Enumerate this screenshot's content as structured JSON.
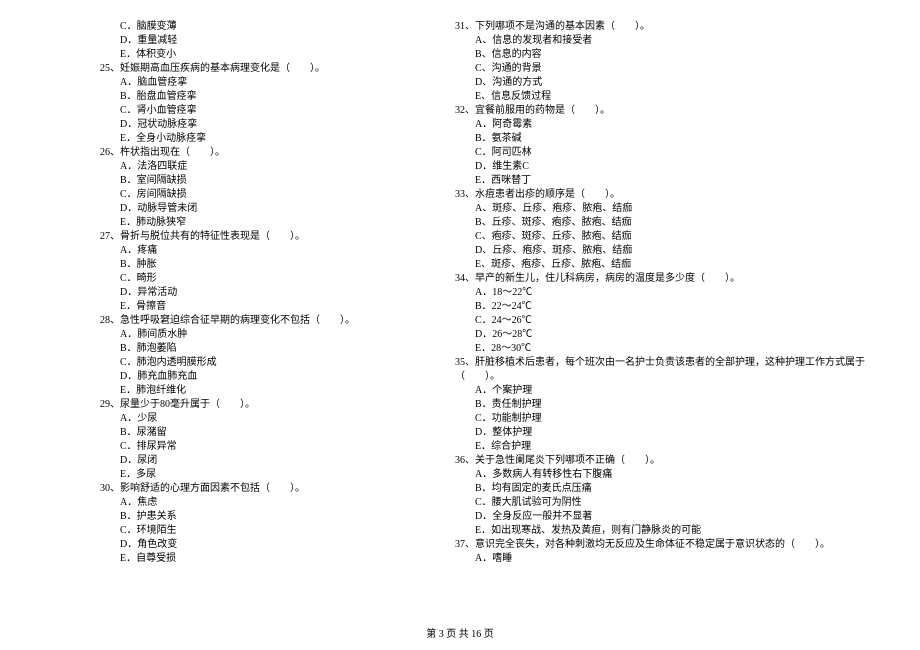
{
  "left_column": [
    {
      "type": "option",
      "text": "C．脑膜变薄"
    },
    {
      "type": "option",
      "text": "D．重量减轻"
    },
    {
      "type": "option",
      "text": "E．体积变小"
    },
    {
      "type": "question",
      "text": "25、妊娠期高血压疾病的基本病理变化是（　　）。"
    },
    {
      "type": "option",
      "text": "A．脑血管痉挛"
    },
    {
      "type": "option",
      "text": "B．胎盘血管痉挛"
    },
    {
      "type": "option",
      "text": "C．肾小血管痉挛"
    },
    {
      "type": "option",
      "text": "D．冠状动脉痉挛"
    },
    {
      "type": "option",
      "text": "E．全身小动脉痉挛"
    },
    {
      "type": "question",
      "text": "26、杵状指出现在（　　）。"
    },
    {
      "type": "option",
      "text": "A．法洛四联症"
    },
    {
      "type": "option",
      "text": "B．室间隔缺损"
    },
    {
      "type": "option",
      "text": "C．房间隔缺损"
    },
    {
      "type": "option",
      "text": "D．动脉导管未闭"
    },
    {
      "type": "option",
      "text": "E．肺动脉狭窄"
    },
    {
      "type": "question",
      "text": "27、骨折与脱位共有的特征性表现是（　　）。"
    },
    {
      "type": "option",
      "text": "A．疼痛"
    },
    {
      "type": "option",
      "text": "B．肿胀"
    },
    {
      "type": "option",
      "text": "C．畸形"
    },
    {
      "type": "option",
      "text": "D．异常活动"
    },
    {
      "type": "option",
      "text": "E．骨擦音"
    },
    {
      "type": "question",
      "text": "28、急性呼吸窘迫综合征早期的病理变化不包括（　　）。"
    },
    {
      "type": "option",
      "text": "A．肺间质水肿"
    },
    {
      "type": "option",
      "text": "B．肺泡萎陷"
    },
    {
      "type": "option",
      "text": "C．肺泡内透明膜形成"
    },
    {
      "type": "option",
      "text": "D．肺充血肺充血"
    },
    {
      "type": "option",
      "text": "E．肺泡纤维化"
    },
    {
      "type": "question",
      "text": "29、尿量少于80毫升属于（　　）。"
    },
    {
      "type": "option",
      "text": "A．少尿"
    },
    {
      "type": "option",
      "text": "B．尿潴留"
    },
    {
      "type": "option",
      "text": "C．排尿异常"
    },
    {
      "type": "option",
      "text": "D．尿闭"
    },
    {
      "type": "option",
      "text": "E．多尿"
    },
    {
      "type": "question",
      "text": "30、影响舒适的心理方面因素不包括（　　）。"
    },
    {
      "type": "option",
      "text": "A．焦虑"
    },
    {
      "type": "option",
      "text": "B．护患关系"
    },
    {
      "type": "option",
      "text": "C．环境陌生"
    },
    {
      "type": "option",
      "text": "D．角色改变"
    },
    {
      "type": "option",
      "text": "E．自尊受损"
    }
  ],
  "right_column": [
    {
      "type": "question",
      "text": "31、下列哪项不是沟通的基本因素（　　）。"
    },
    {
      "type": "option",
      "text": "A、信息的发现者和接受者"
    },
    {
      "type": "option",
      "text": "B、信息的内容"
    },
    {
      "type": "option",
      "text": "C、沟通的背景"
    },
    {
      "type": "option",
      "text": "D、沟通的方式"
    },
    {
      "type": "option",
      "text": "E、信息反馈过程"
    },
    {
      "type": "question",
      "text": "32、宜餐前服用的药物是（　　）。"
    },
    {
      "type": "option",
      "text": "A．阿奇霉素"
    },
    {
      "type": "option",
      "text": "B．氨茶碱"
    },
    {
      "type": "option",
      "text": "C．阿司匹林"
    },
    {
      "type": "option",
      "text": "D．维生素C"
    },
    {
      "type": "option",
      "text": "E．西咪替丁"
    },
    {
      "type": "question",
      "text": "33、水痘患者出疹的顺序是（　　）。"
    },
    {
      "type": "option",
      "text": "A、斑疹、丘疹、疱疹、脓疱、结痂"
    },
    {
      "type": "option",
      "text": "B、丘疹、斑疹、疱疹、脓疱、结痂"
    },
    {
      "type": "option",
      "text": "C、疱疹、斑疹、丘疹、脓疱、结痂"
    },
    {
      "type": "option",
      "text": "D、丘疹、疱疹、斑疹、脓疱、结痂"
    },
    {
      "type": "option",
      "text": "E、斑疹、疱疹、丘疹、脓疱、结痂"
    },
    {
      "type": "question",
      "text": "34、早产的新生儿，住儿科病房，病房的温度是多少度（　　）。"
    },
    {
      "type": "option",
      "text": "A．18～22℃"
    },
    {
      "type": "option",
      "text": "B．22～24℃"
    },
    {
      "type": "option",
      "text": "C．24～26℃"
    },
    {
      "type": "option",
      "text": "D．26～28℃"
    },
    {
      "type": "option",
      "text": "E．28～30℃"
    },
    {
      "type": "question",
      "text": "35、肝脏移植术后患者，每个班次由一名护士负责该患者的全部护理，这种护理工作方式属于"
    },
    {
      "type": "question",
      "text": "（　　）。"
    },
    {
      "type": "option",
      "text": "A．个案护理"
    },
    {
      "type": "option",
      "text": "B．责任制护理"
    },
    {
      "type": "option",
      "text": "C．功能制护理"
    },
    {
      "type": "option",
      "text": "D．整体护理"
    },
    {
      "type": "option",
      "text": "E．综合护理"
    },
    {
      "type": "question",
      "text": "36、关于急性阑尾炎下列哪项不正确（　　）。"
    },
    {
      "type": "option",
      "text": "A．多数病人有转移性右下腹痛"
    },
    {
      "type": "option",
      "text": "B．均有固定的麦氏点压痛"
    },
    {
      "type": "option",
      "text": "C．腰大肌试验可为阴性"
    },
    {
      "type": "option",
      "text": "D．全身反应一般并不显著"
    },
    {
      "type": "option",
      "text": "E．如出现寒战、发热及黄疸，则有门静脉炎的可能"
    },
    {
      "type": "question",
      "text": "37、意识完全丧失，对各种刺激均无反应及生命体征不稳定属于意识状态的（　　）。"
    },
    {
      "type": "option",
      "text": "A．嗜睡"
    }
  ],
  "footer": "第 3 页 共 16 页"
}
